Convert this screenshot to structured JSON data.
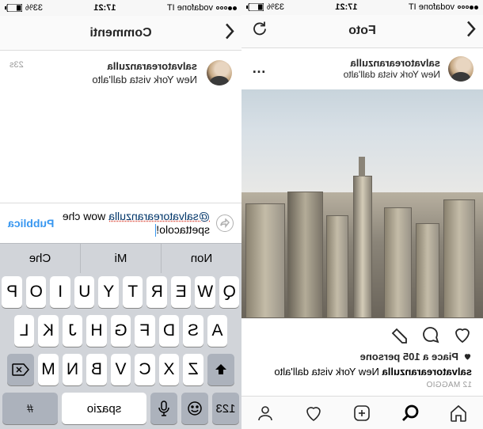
{
  "status": {
    "carrier": "vodafone IT",
    "time": "17:21",
    "battery": "33%"
  },
  "photo_screen": {
    "nav_title": "Foto",
    "username": "salvatorearanzulla",
    "location": "New York vista dall'alto",
    "likes_text": "Piace a 105 persone",
    "caption_user": "salvatorearanzulla",
    "caption_text": "New York vista dall'alto",
    "date": "12 MAGGIO"
  },
  "comments_screen": {
    "nav_title": "Commenti",
    "username": "salvatorearanzulla",
    "caption_text": "New York vista dall'alto",
    "time_ago": "23s",
    "compose_mention": "@salvatorearanzulla",
    "compose_text_1": "wow che",
    "compose_text_2": "spettacolo!",
    "publish": "Pubblica",
    "suggestions": [
      "Non",
      "Mi",
      "Che"
    ]
  },
  "keyboard": {
    "rows": [
      [
        "Q",
        "W",
        "E",
        "R",
        "T",
        "Y",
        "U",
        "I",
        "O",
        "P"
      ],
      [
        "A",
        "S",
        "D",
        "F",
        "G",
        "H",
        "J",
        "K",
        "L"
      ],
      [
        "Z",
        "X",
        "C",
        "V",
        "B",
        "N",
        "M"
      ]
    ],
    "num_label": "123",
    "space_label": "spazio",
    "return_label": "#"
  }
}
